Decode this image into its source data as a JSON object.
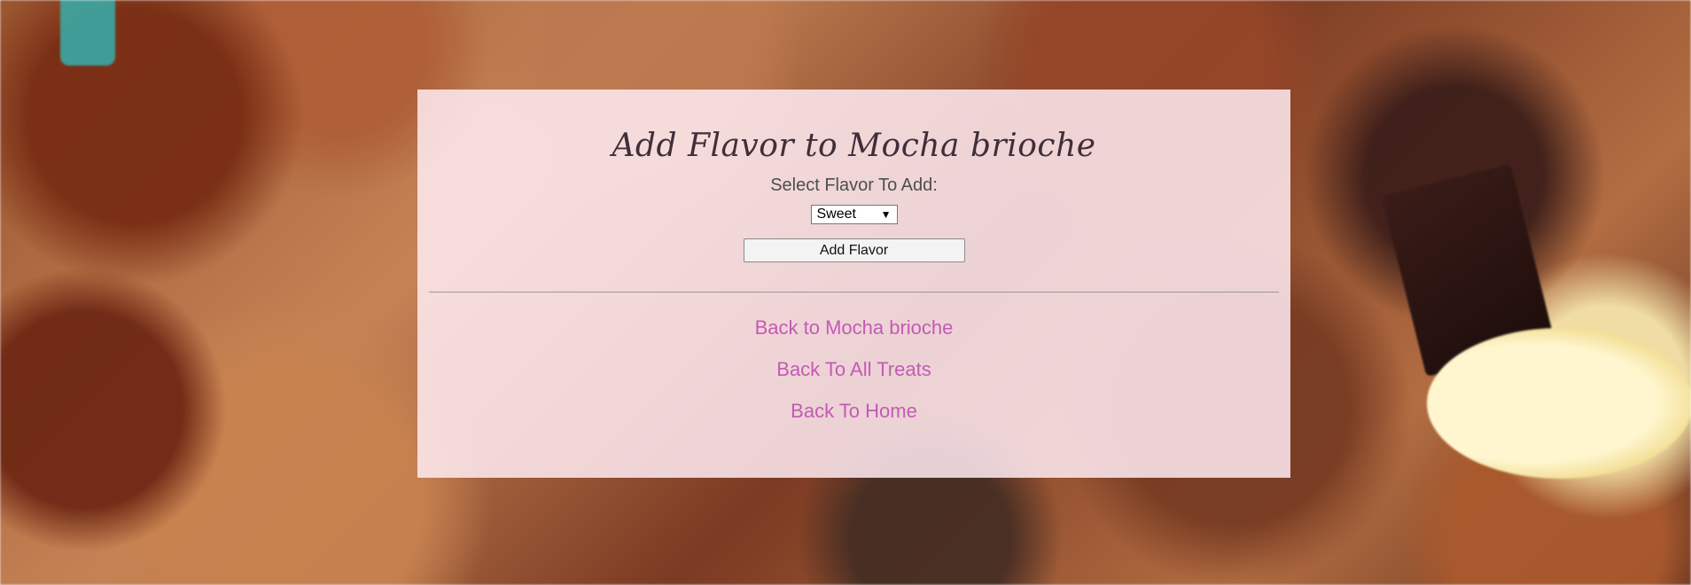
{
  "page": {
    "title": "Add Flavor to Mocha brioche"
  },
  "form": {
    "select_label": "Select Flavor To Add:",
    "selected_flavor": "Sweet",
    "submit_label": "Add Flavor"
  },
  "links": [
    {
      "label": "Back to Mocha brioche"
    },
    {
      "label": "Back To All Treats"
    },
    {
      "label": "Back To Home"
    }
  ],
  "colors": {
    "panel_background": "#ffebf2",
    "link_color": "#c45ab6",
    "title_color": "#3f2f3a"
  }
}
